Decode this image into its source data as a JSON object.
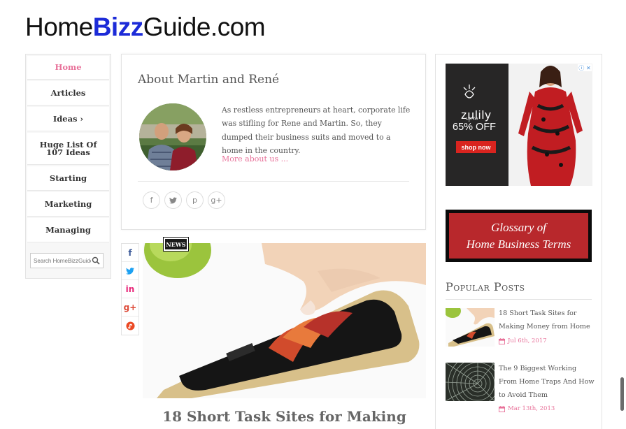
{
  "logo": {
    "part1": "Home",
    "part2": "Bizz",
    "part3": "Guide.com"
  },
  "nav": {
    "items": [
      {
        "label": "Home",
        "active": true
      },
      {
        "label": "Articles"
      },
      {
        "label": "Ideas ›"
      },
      {
        "label": "Huge List Of 107 Ideas"
      },
      {
        "label": "Starting"
      },
      {
        "label": "Marketing"
      },
      {
        "label": "Managing"
      }
    ],
    "search_placeholder": "Search HomeBizzGuide"
  },
  "about": {
    "title": "About Martin and René",
    "text": "As restless entrepreneurs at heart, corporate life was stifling for Rene and Martin. So, they dumped their business suits and moved to a home in the country.",
    "more_link": "More about us ...",
    "social": [
      "f",
      "t",
      "p",
      "g+"
    ]
  },
  "share_bar": {
    "icons": [
      "facebook-icon",
      "twitter-icon",
      "linkedin-icon",
      "google-plus-icon",
      "stumbleupon-icon"
    ]
  },
  "post": {
    "badge": "NEWS",
    "title": "18 Short Task Sites for Making"
  },
  "ad": {
    "brand": "zulily",
    "up_to": "up to",
    "discount": "65% OFF",
    "button": "shop now"
  },
  "glossary": {
    "line1": "Glossary of",
    "line2": "Home Business Terms"
  },
  "popular_posts": {
    "title": "Popular Posts",
    "items": [
      {
        "title": "18 Short Task Sites for Making Money from Home",
        "date": "Jul 6th, 2017"
      },
      {
        "title": "The 9 Biggest Working From Home Traps And How to Avoid Them",
        "date": "Mar 13th, 2013"
      }
    ]
  },
  "colors": {
    "accent": "#e8729a",
    "logo_blue": "#1c2bd8",
    "glossary_red": "#b8282c"
  }
}
